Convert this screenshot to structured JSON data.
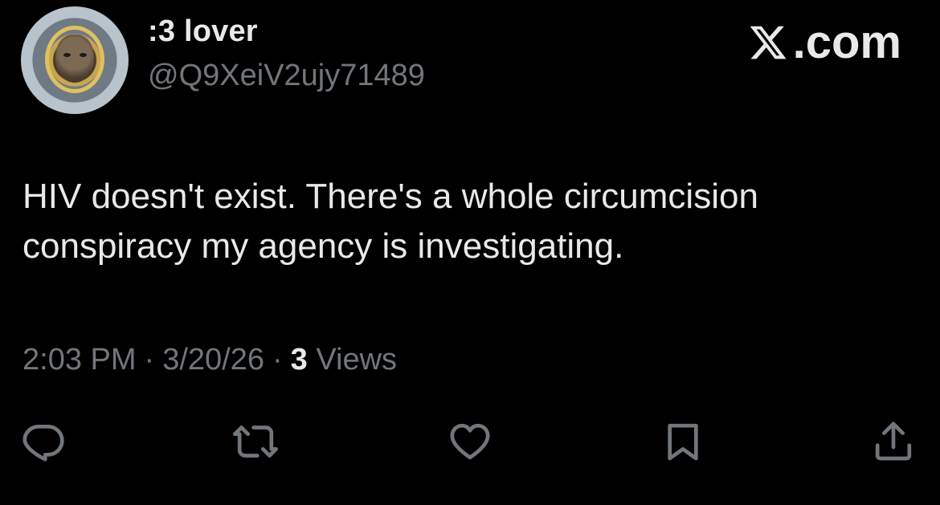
{
  "user": {
    "display_name": ":3 lover",
    "handle": "@Q9XeiV2ujy71489",
    "avatar_icon": "profile-photo"
  },
  "brand": {
    "logo_icon": "x-logo-icon",
    "label": ".com"
  },
  "tweet": {
    "text_line1": "HIV doesn't exist. There's a whole circumcision",
    "text_line2": "conspiracy my agency is investigating."
  },
  "meta": {
    "time": "2:03 PM",
    "separator": "·",
    "date": "3/20/26",
    "views_count": "3",
    "views_label": "Views"
  },
  "actions": {
    "reply_icon": "reply-icon",
    "retweet_icon": "retweet-icon",
    "like_icon": "heart-icon",
    "bookmark_icon": "bookmark-icon",
    "share_icon": "share-icon"
  },
  "colors": {
    "background": "#000000",
    "text_primary": "#e7e9ea",
    "text_secondary": "#71767b"
  }
}
